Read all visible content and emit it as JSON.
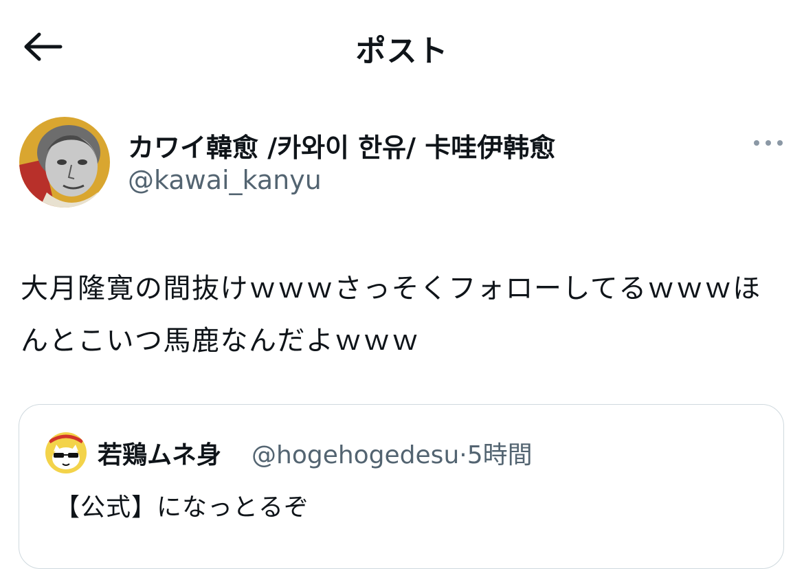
{
  "header": {
    "title": "ポスト",
    "back_icon": "arrow-left-icon"
  },
  "post": {
    "author": {
      "display_name": "カワイ韓愈 /카와이 한유/ 卡哇伊韩愈",
      "handle": "@kawai_kanyu",
      "avatar": "portrait-avatar"
    },
    "more_icon": "more-horizontal-icon",
    "text": "大月隆寛の間抜けｗｗｗさっそくフォローしてるｗｗｗほんとこいつ馬鹿なんだよｗｗｗ"
  },
  "quoted_post": {
    "display_name": "若鶏ムネ身",
    "handle": "@hogehogedesu",
    "separator": "·",
    "time": "5時間",
    "text": "【公式】になっとるぞ",
    "avatar": "cat-sunglasses-avatar"
  },
  "colors": {
    "text_primary": "#0f1419",
    "text_secondary": "#536471",
    "border": "#cfd9de"
  }
}
